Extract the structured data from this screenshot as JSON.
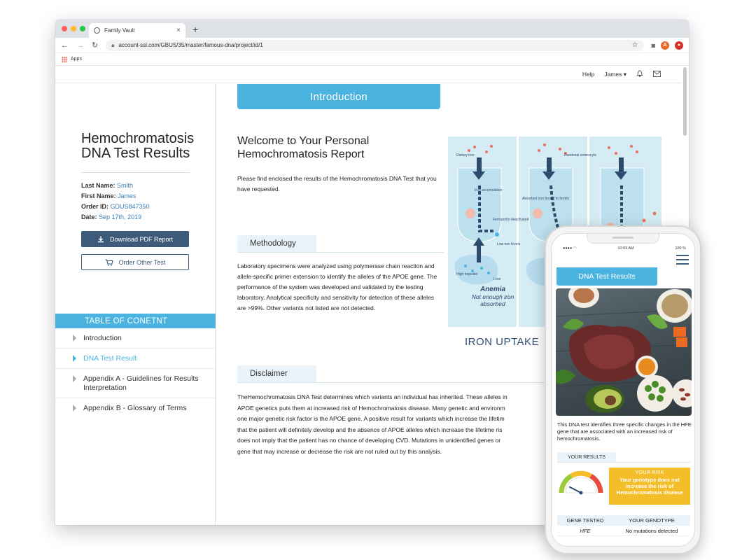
{
  "browser": {
    "tab_title": "Family Vault",
    "url": "account-ssl.com/GBUS/35/master/famous-dna/project/id/1",
    "bookmarks_apps": "Apps",
    "ext_a": "A"
  },
  "topnav": {
    "help": "Help",
    "user": "James ▾"
  },
  "sidebar": {
    "title": "Hemochromatosis DNA Test Results",
    "last_name_label": "Last Name:",
    "last_name": "Smith",
    "first_name_label": "First Name:",
    "first_name": "James",
    "order_id_label": "Order ID:",
    "order_id": "GDUS847350",
    "date_label": "Date:",
    "date": "Sep 17th, 2019",
    "download_label": "Download PDF Report",
    "order_label": "Order Other Test",
    "toc_title": "TABLE OF CONETNT",
    "toc": [
      {
        "label": "Introduction",
        "active": false
      },
      {
        "label": "DNA Test Result",
        "active": true
      },
      {
        "label": "Appendix A - Guidelines for Results Interpretation",
        "active": false
      },
      {
        "label": "Appendix B - Glossary of Terms",
        "active": false
      }
    ]
  },
  "main": {
    "intro_tab": "Introduction",
    "welcome_title": "Welcome to Your Personal Hemochromatosis Report",
    "welcome_body": "Please find enclosed the results of the Hemochromatosis DNA Test that you have requested.",
    "methodology_title": "Methodology",
    "methodology_body": "Laboratory specimens were analyzed using polymerase chain reaction and allele-specific primer extension to identify the alleles of the APOE gene. The performance of the system was developed and validated by the testing laboratory. Analytical specificity and sensitivity for detection of these alleles are >99%. Other variants not listed are not detected.",
    "disclaimer_title": "Disclaimer",
    "disclaimer_lines": [
      "TheHemochromatosis DNA Test determines which variants an individual has inherited. These alleles in",
      "APOE genetics puts them at increased risk of Hemochromatosis disease. Many genetic and environm",
      "one major genetic risk factor is the APOE gene. A positive result for variants which increase the lifetim",
      "that the patient will definitely develop and the absence of APOE alleles which increase the lifetime ris",
      "does not imply that the patient has no chance of developing CVD. Mutations in unidentified genes or",
      "gene that may increase or decrease the risk are not ruled out by this analysis."
    ]
  },
  "iron_figure": {
    "title": "IRON UPTAKE",
    "caption_title": "Anemia",
    "caption_sub": "Not enough iron absorbed",
    "labels": {
      "dietary_iron": "Dietary iron",
      "iron_accumulation": "Iron accumulation",
      "ferroportin": "Ferroportin deactivated",
      "low_iron": "Low iron levels",
      "high_hepcidin": "High hepcidin",
      "liver": "Liver",
      "duodenal": "Duodenal enterocyte",
      "absorbed": "Absorbed iron bound to ferritin"
    }
  },
  "phone": {
    "time": "10:09 AM",
    "battery": "100 %",
    "tab": "DNA Test Results",
    "desc": "This DNA test identifies three specific changes in the HFE gene that are associated with an increased risk of hemochromatosis.",
    "your_results": "YOUR RESULTS",
    "your_risk_title": "YOUR RISK",
    "your_risk_text": "Your genotype does not increase the risk of Hemochromatosis disease",
    "table_headers": [
      "GENE TESTED",
      "YOUR GENOTYPE"
    ],
    "table_rows": [
      [
        "HFE",
        "No mutations detected"
      ]
    ],
    "gauge_level": 0.15
  },
  "colors": {
    "accent": "#4bb3e0",
    "navy": "#3d5a7a",
    "risk": "#f4bd2a"
  }
}
